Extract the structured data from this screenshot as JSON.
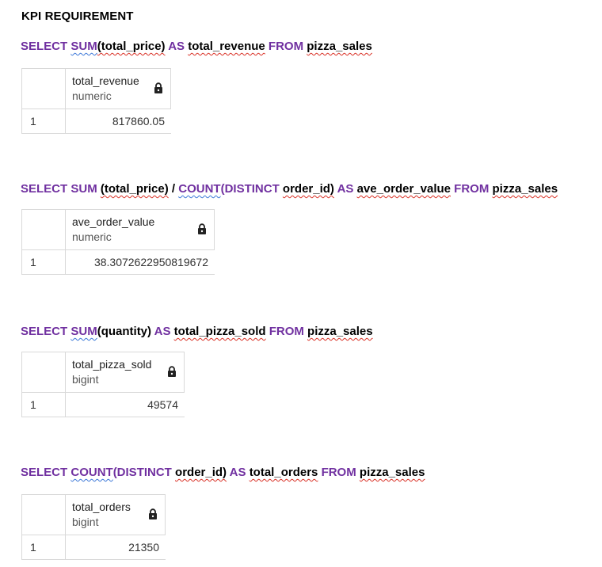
{
  "heading": "KPI REQUIREMENT",
  "lock_icon": "lock-icon",
  "queries": [
    {
      "sql": {
        "kw1": "SELECT",
        "fn": "SUM",
        "arg": "(total_price)",
        "as": "AS",
        "alias": "total_revenue",
        "from": "FROM",
        "table": "pizza_sales"
      },
      "result": {
        "column_name": "total_revenue",
        "column_type": "numeric",
        "row_number": "1",
        "value": "817860.05"
      }
    },
    {
      "sql": {
        "kw1": "SELECT",
        "fn": "SUM",
        "arg": "(total_price)",
        "op": "/",
        "fn2": "COUNT",
        "distinct": "(DISTINCT",
        "arg2": "order_id)",
        "as": "AS",
        "alias": "ave_order_value",
        "from": "FROM",
        "table": "pizza_sales"
      },
      "result": {
        "column_name": "ave_order_value",
        "column_type": "numeric",
        "row_number": "1",
        "value": "38.3072622950819672"
      }
    },
    {
      "sql": {
        "kw1": "SELECT",
        "fn": "SUM",
        "arg": "(quantity)",
        "as": "AS",
        "alias": "total_pizza_sold",
        "from": "FROM",
        "table": "pizza_sales"
      },
      "result": {
        "column_name": "total_pizza_sold",
        "column_type": "bigint",
        "row_number": "1",
        "value": "49574"
      }
    },
    {
      "sql": {
        "kw1": "SELECT",
        "fn": "COUNT",
        "distinct": "(DISTINCT",
        "arg": "order_id)",
        "as": "AS",
        "alias": "total_orders",
        "from": "FROM",
        "table": "pizza_sales"
      },
      "result": {
        "column_name": "total_orders",
        "column_type": "bigint",
        "row_number": "1",
        "value": "21350"
      }
    }
  ]
}
